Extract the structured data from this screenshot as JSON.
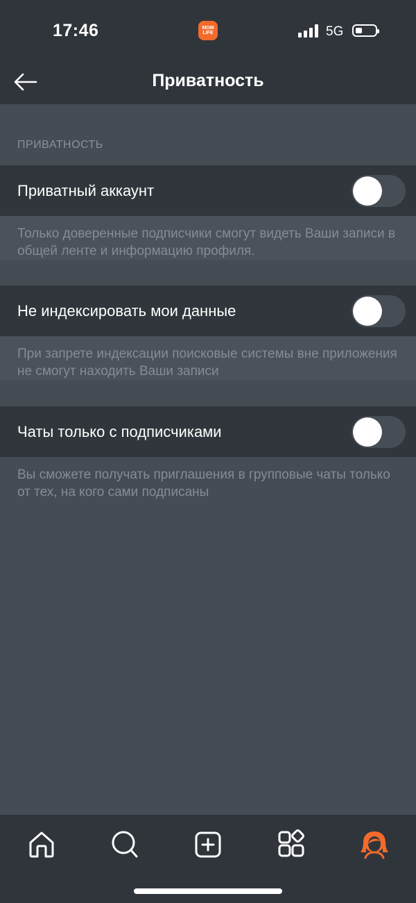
{
  "status_bar": {
    "time": "17:46",
    "app_badge_text": "MOM LIFE",
    "network": "5G",
    "battery_level": 0.25,
    "signal_bars": 4
  },
  "nav": {
    "title": "Приватность",
    "back_icon": "arrow-left-icon"
  },
  "section_header": "ПРИВАТНОСТЬ",
  "settings": [
    {
      "label": "Приватный аккаунт",
      "enabled": false,
      "description": "Только доверенные подписчики смогут видеть Ваши записи в общей ленте и информацию профиля."
    },
    {
      "label": "Не индексировать мои данные",
      "enabled": false,
      "description": "При запрете индексации поисковые системы вне приложения не смогут находить Ваши записи"
    },
    {
      "label": "Чаты только с подписчиками",
      "enabled": false,
      "description": "Вы сможете получать приглашения в групповые чаты только от тех, на кого сами подписаны"
    }
  ],
  "tab_bar": {
    "items": [
      "home-icon",
      "search-icon",
      "add-post-icon",
      "apps-grid-icon",
      "profile-avatar-icon"
    ],
    "active": "profile-avatar-icon",
    "accent_color": "#f26b2c"
  },
  "colors": {
    "background": "#464c54",
    "bars": "#30353b",
    "row": "#31363c",
    "muted_text": "#858c94"
  }
}
